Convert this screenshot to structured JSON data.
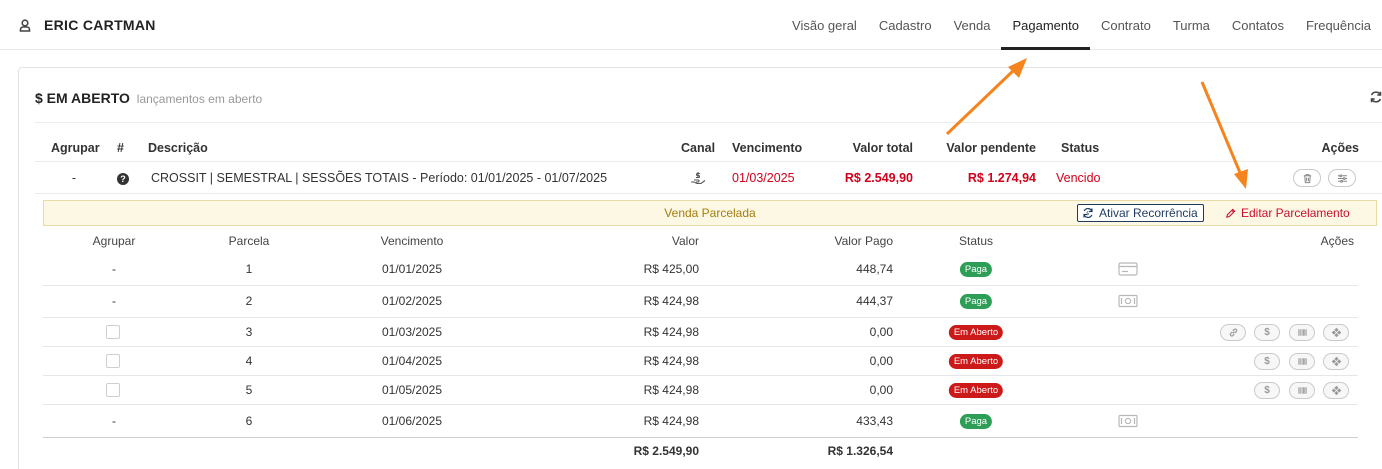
{
  "header": {
    "user_name": "ERIC CARTMAN",
    "tabs": [
      "Visão geral",
      "Cadastro",
      "Venda",
      "Pagamento",
      "Contrato",
      "Turma",
      "Contatos",
      "Frequência"
    ],
    "active_tab": "Pagamento"
  },
  "section": {
    "title": "$ EM ABERTO",
    "subtitle": "lançamentos em aberto"
  },
  "main_table": {
    "headers": {
      "agrupar": "Agrupar",
      "num": "#",
      "descricao": "Descrição",
      "canal": "Canal",
      "vencimento": "Vencimento",
      "valor_total": "Valor total",
      "valor_pendente": "Valor pendente",
      "status": "Status",
      "acoes": "Ações"
    },
    "row": {
      "agrupar": "-",
      "descricao": "CROSSIT | SEMESTRAL | SESSÕES TOTAIS - Período: 01/01/2025 - 01/07/2025",
      "vencimento": "01/03/2025",
      "valor_total": "R$ 2.549,90",
      "valor_pendente": "R$ 1.274,94",
      "status": "Vencido"
    }
  },
  "installments": {
    "banner_title": "Venda Parcelada",
    "ativar_recorrencia": "Ativar Recorrência",
    "editar_parcelamento": "Editar Parcelamento",
    "headers": {
      "agrupar": "Agrupar",
      "parcela": "Parcela",
      "vencimento": "Vencimento",
      "valor": "Valor",
      "valor_pago": "Valor Pago",
      "status": "Status",
      "acoes": "Ações"
    },
    "rows": [
      {
        "agrupar": "-",
        "parcela": "1",
        "vencimento": "01/01/2025",
        "valor": "R$ 425,00",
        "valor_pago": "448,74",
        "status": "Paga"
      },
      {
        "agrupar": "-",
        "parcela": "2",
        "vencimento": "01/02/2025",
        "valor": "R$ 424,98",
        "valor_pago": "444,37",
        "status": "Paga"
      },
      {
        "agrupar": "",
        "parcela": "3",
        "vencimento": "01/03/2025",
        "valor": "R$ 424,98",
        "valor_pago": "0,00",
        "status": "Em Aberto"
      },
      {
        "agrupar": "",
        "parcela": "4",
        "vencimento": "01/04/2025",
        "valor": "R$ 424,98",
        "valor_pago": "0,00",
        "status": "Em Aberto"
      },
      {
        "agrupar": "",
        "parcela": "5",
        "vencimento": "01/05/2025",
        "valor": "R$ 424,98",
        "valor_pago": "0,00",
        "status": "Em Aberto"
      },
      {
        "agrupar": "-",
        "parcela": "6",
        "vencimento": "01/06/2025",
        "valor": "R$ 424,98",
        "valor_pago": "433,43",
        "status": "Paga"
      }
    ],
    "totals": {
      "valor": "R$ 2.549,90",
      "valor_pago": "R$ 1.326,54"
    }
  },
  "colors": {
    "accent_red": "#d0021b",
    "paid_green": "#2e9e57",
    "open_red": "#cc1a1a",
    "banner_bg": "#fdf8e3",
    "annotation_arrow": "#f5841f"
  },
  "icons": {
    "user": "user-icon",
    "refresh": "refresh-icon",
    "help": "question-circle-icon",
    "canal": "hand-money-icon",
    "trash": "trash-icon",
    "sliders": "sliders-icon",
    "recurrence": "recurrence-icon",
    "edit": "pencil-icon",
    "card": "credit-card-icon",
    "cash": "cash-icon",
    "link": "link-icon",
    "dollar": "dollar-icon",
    "barcode": "barcode-icon",
    "pix": "pix-icon"
  }
}
